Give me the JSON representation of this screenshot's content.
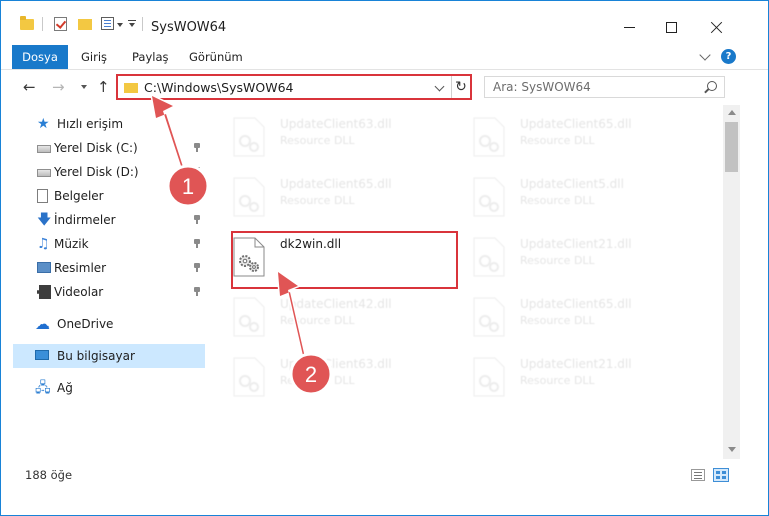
{
  "window": {
    "title": "SysWOW64"
  },
  "ribbon": {
    "tabs": [
      "Dosya",
      "Giriş",
      "Paylaş",
      "Görünüm"
    ]
  },
  "address": {
    "path": "C:\\Windows\\SysWOW64",
    "search_placeholder": "Ara: SysWOW64"
  },
  "sidebar": {
    "quick_access": "Hızlı erişim",
    "items": [
      {
        "label": "Yerel Disk (C:)",
        "icon": "drive-icon",
        "pinned": true
      },
      {
        "label": "Yerel Disk (D:)",
        "icon": "drive-icon",
        "pinned": true
      },
      {
        "label": "Belgeler",
        "icon": "documents-icon",
        "pinned": true
      },
      {
        "label": "İndirmeler",
        "icon": "downloads-icon",
        "pinned": true
      },
      {
        "label": "Müzik",
        "icon": "music-icon",
        "pinned": true
      },
      {
        "label": "Resimler",
        "icon": "pictures-icon",
        "pinned": true
      },
      {
        "label": "Videolar",
        "icon": "videos-icon",
        "pinned": true
      }
    ],
    "onedrive": "OneDrive",
    "this_pc": "Bu bilgisayar",
    "network": "Ağ"
  },
  "files": [
    {
      "name": "UpdateClient63.dll",
      "type": "Resource DLL"
    },
    {
      "name": "UpdateClient65.dll",
      "type": "Resource DLL"
    },
    {
      "name": "UpdateClient65.dll",
      "type": "Resource DLL"
    },
    {
      "name": "UpdateClient5.dll",
      "type": "Resource DLL"
    },
    {
      "name": "dk2win.dll",
      "type": ""
    },
    {
      "name": "UpdateClient21.dll",
      "type": "Resource DLL"
    },
    {
      "name": "UpdateClient42.dll",
      "type": "Resource DLL"
    },
    {
      "name": "UpdateClient65.dll",
      "type": "Resource DLL"
    },
    {
      "name": "UpdateClient63.dll",
      "type": "Resource DLL"
    },
    {
      "name": "UpdateClient21.dll",
      "type": "Resource DLL"
    }
  ],
  "status": {
    "count": "188 öğe"
  },
  "callouts": [
    "1",
    "2"
  ],
  "colors": {
    "accent": "#1979ca",
    "highlight": "#d9343b",
    "selection": "#cce8ff"
  }
}
